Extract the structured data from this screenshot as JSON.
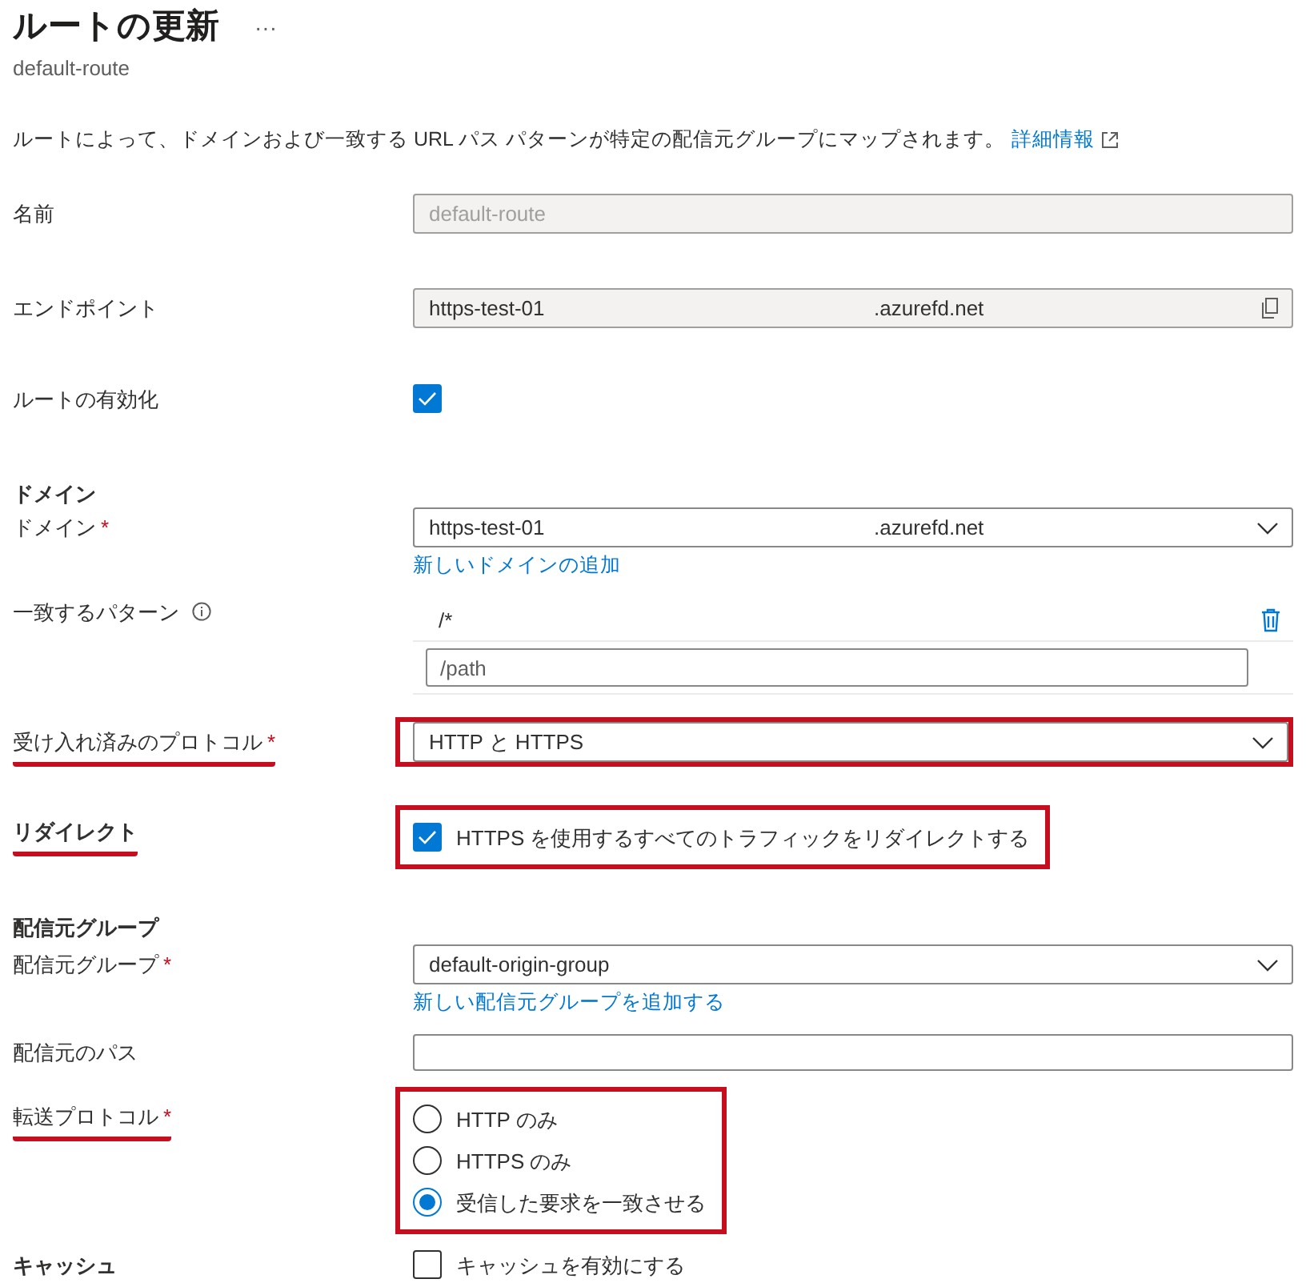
{
  "header": {
    "title": "ルートの更新",
    "more": "···",
    "subtitle": "default-route"
  },
  "description": {
    "text": "ルートによって、ドメインおよび一致する URL パス パターンが特定の配信元グループにマップされます。",
    "link": "詳細情報"
  },
  "rows": [
    {
      "kind": "readonly",
      "label": "名前",
      "value": "default-route"
    },
    {
      "kind": "copy",
      "label": "エンドポイント",
      "value_parts": [
        "https-test-01",
        ".azurefd.net"
      ]
    },
    {
      "kind": "checkbox",
      "label": "ルートの有効化",
      "checked": true
    },
    {
      "kind": "section",
      "label": "ドメイン"
    },
    {
      "kind": "dropdown",
      "label": "ドメイン",
      "required_mark": "*",
      "value_parts": [
        "https-test-01",
        ".azurefd.net"
      ],
      "link": "新しいドメインの追加"
    },
    {
      "kind": "patterns",
      "label": "一致するパターン",
      "info": true,
      "items": [
        "/*"
      ],
      "placeholder": "/path"
    },
    {
      "kind": "dropdown",
      "label": "受け入れ済みのプロトコル",
      "required_mark": "*",
      "highlighted": true,
      "value_parts": [
        "HTTP と HTTPS"
      ]
    },
    {
      "kind": "checkbox",
      "label": "リダイレクト",
      "bold": true,
      "highlighted": true,
      "checked": true,
      "text": "HTTPS を使用するすべてのトラフィックをリダイレクトする"
    },
    {
      "kind": "section",
      "label": "配信元グループ"
    },
    {
      "kind": "dropdown",
      "label": "配信元グループ",
      "required_mark": "*",
      "value_parts": [
        "default-origin-group"
      ],
      "link": "新しい配信元グループを追加する"
    },
    {
      "kind": "text",
      "label": "配信元のパス"
    },
    {
      "kind": "radio",
      "label": "転送プロトコル",
      "required_mark": "*",
      "highlighted": true,
      "options": [
        {
          "label": "HTTP のみ",
          "selected": false
        },
        {
          "label": "HTTPS のみ",
          "selected": false
        },
        {
          "label": "受信した要求を一致させる",
          "selected": true
        }
      ]
    },
    {
      "kind": "checkbox",
      "label": "キャッシュ",
      "bold": true,
      "checked": false,
      "text": "キャッシュを有効にする"
    }
  ]
}
